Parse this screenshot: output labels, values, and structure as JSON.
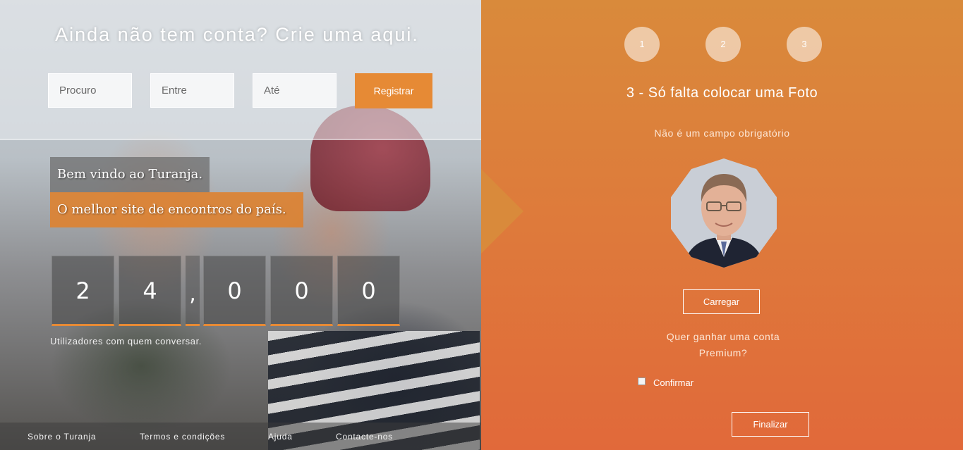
{
  "signup": {
    "title": "Ainda não tem conta? Crie uma aqui.",
    "fields": [
      {
        "placeholder": "Procuro"
      },
      {
        "placeholder": "Entre"
      },
      {
        "placeholder": "Até"
      }
    ],
    "register_label": "Registrar"
  },
  "hero": {
    "welcome": "Bem vindo ao Turanja.",
    "tagline": "O melhor site de encontros do país."
  },
  "counter": {
    "digits": [
      "2",
      "4",
      ",",
      "0",
      "0",
      "0"
    ],
    "caption": "Utilizadores com quem conversar."
  },
  "footer": {
    "links": [
      "Sobre o Turanja",
      "Termos e condições",
      "Ajuda",
      "Contacte-nos"
    ]
  },
  "wizard": {
    "steps": [
      "1",
      "2",
      "3"
    ],
    "title": "3 - Só falta colocar uma Foto",
    "subtitle": "Não é um campo obrigatório",
    "upload_label": "Carregar",
    "premium_question_line1": "Quer ganhar uma conta",
    "premium_question_line2": "Premium?",
    "confirm_label": "Confirmar",
    "finish_label": "Finalizar"
  },
  "colors": {
    "accent": "#e68a35",
    "panel_top": "#d98a3b",
    "panel_bottom": "#e1693a"
  }
}
